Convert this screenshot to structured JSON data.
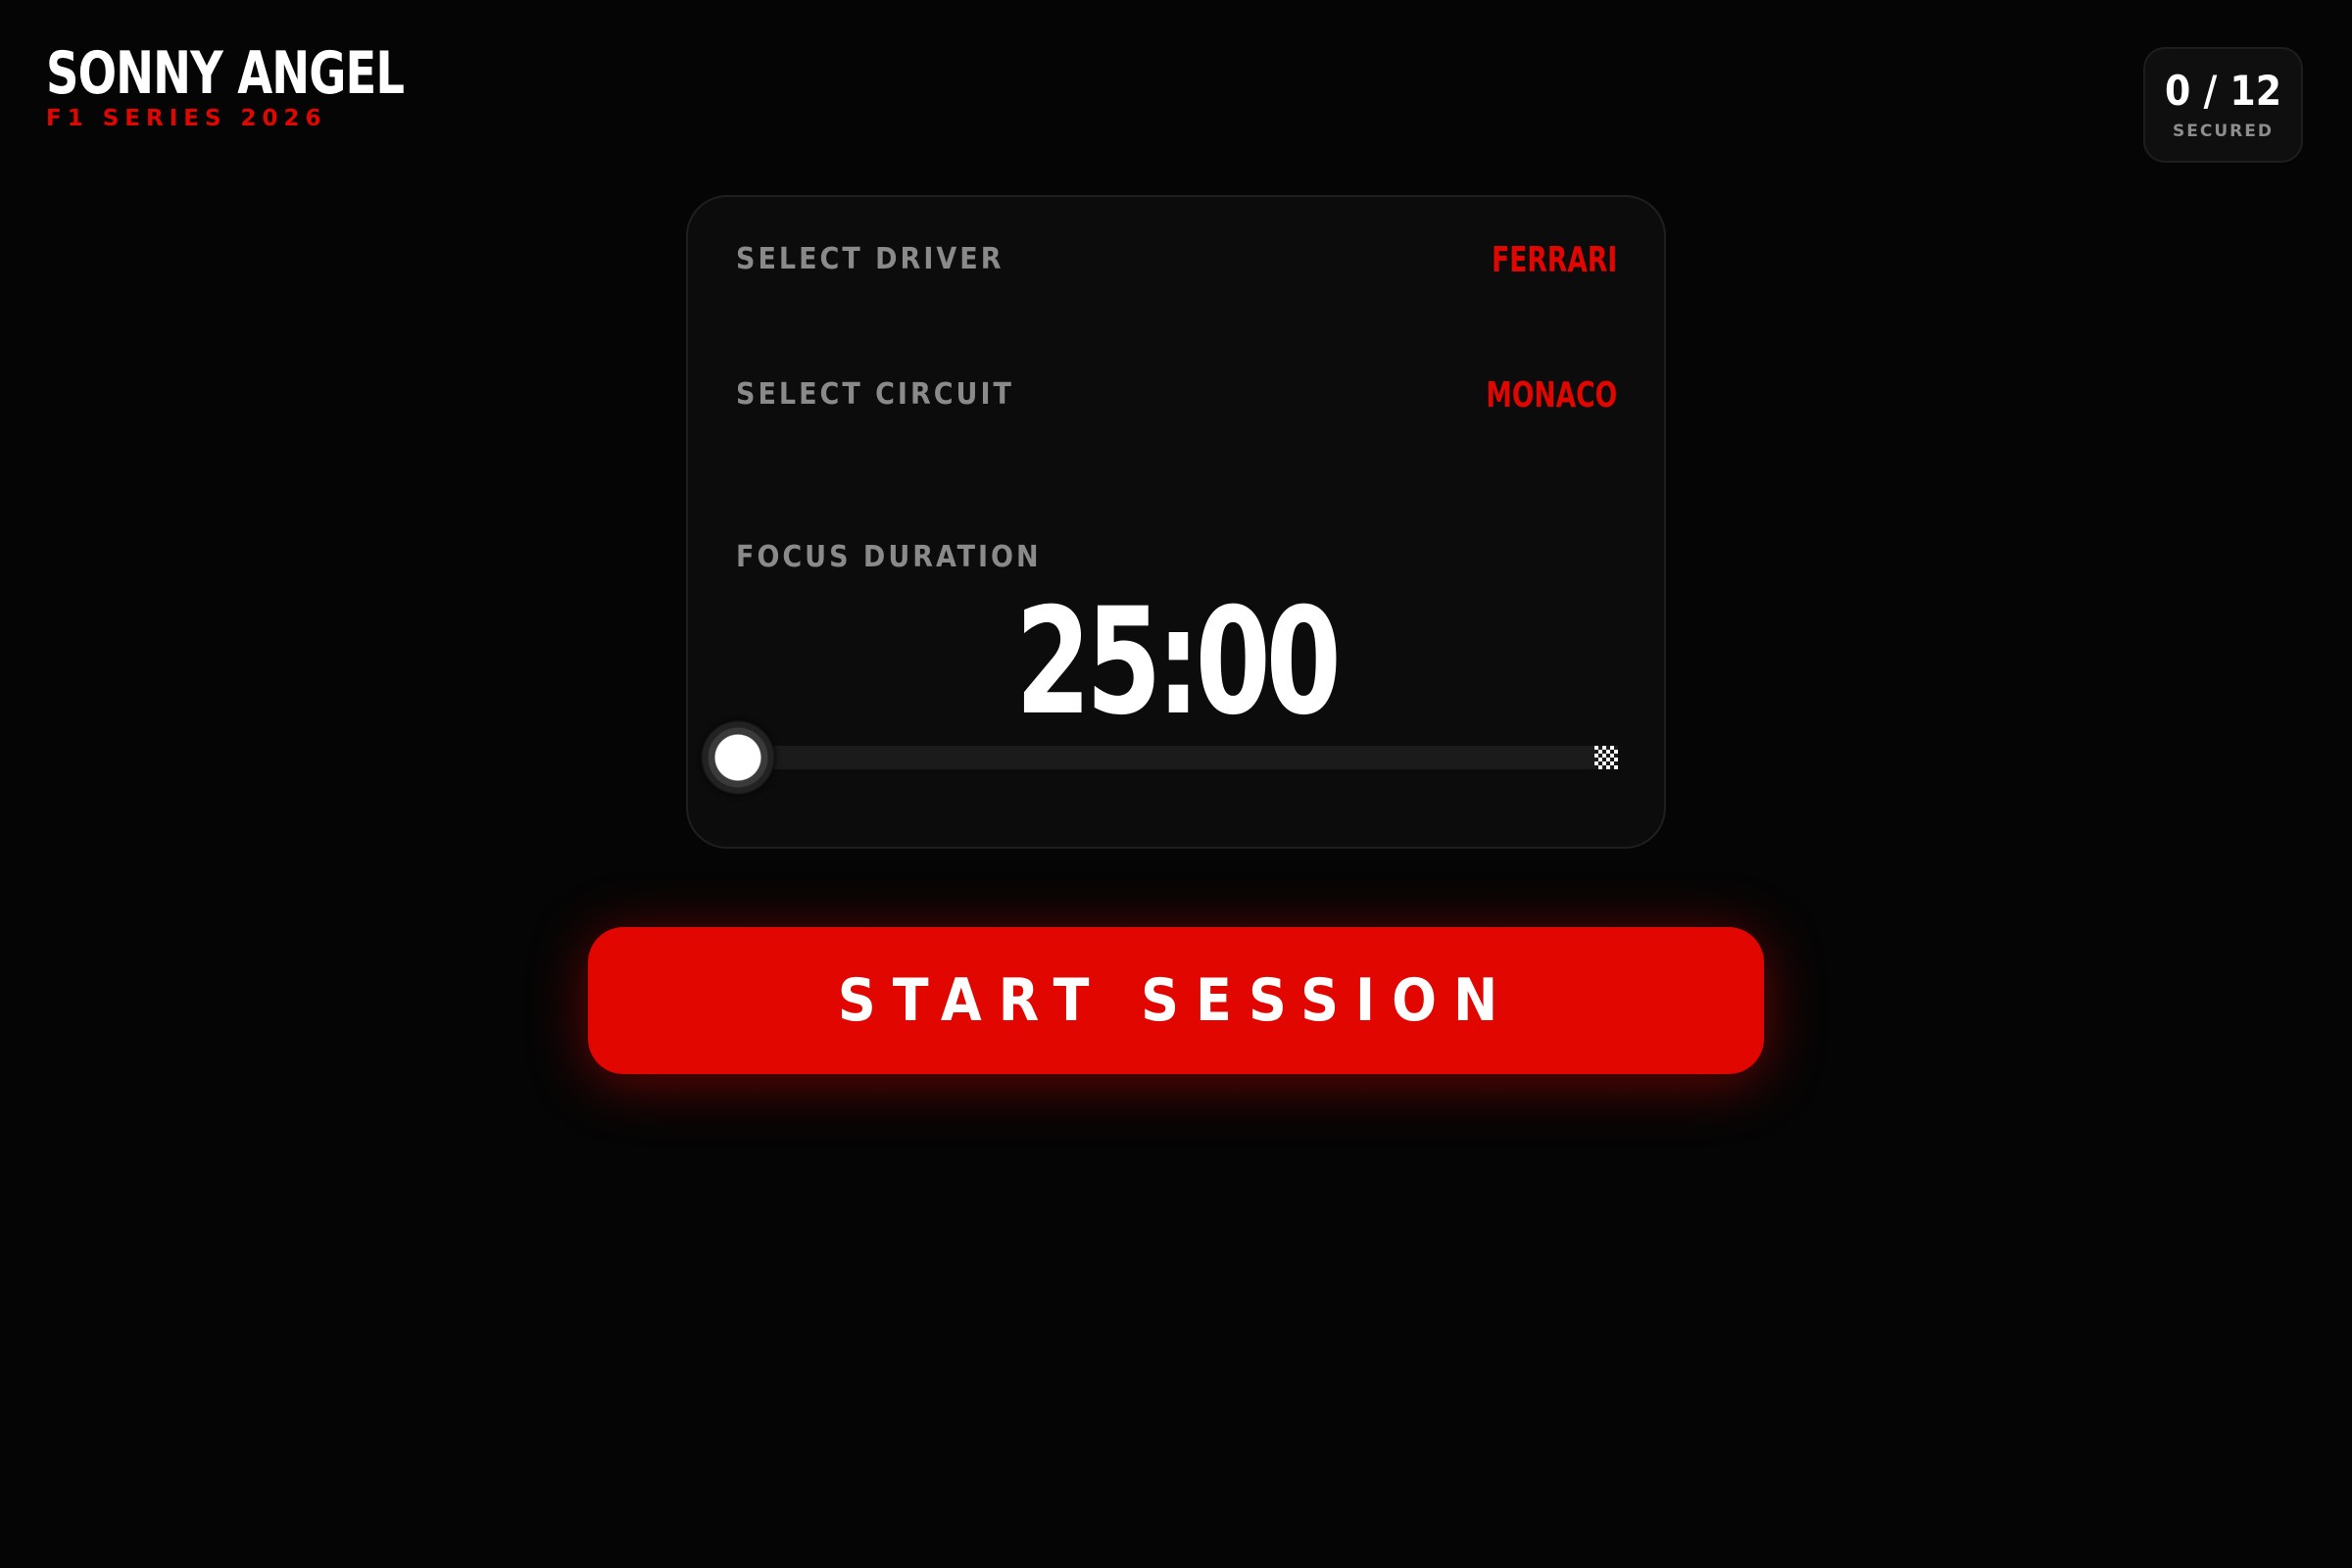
{
  "brand": {
    "title": "SONNY ANGEL",
    "subtitle": "F1 SERIES 2026"
  },
  "counter": {
    "value": "0 / 12",
    "label": "SECURED"
  },
  "card": {
    "driver": {
      "label": "SELECT DRIVER",
      "value": "FERRARI"
    },
    "circuit": {
      "label": "SELECT CIRCUIT",
      "value": "MONACO"
    },
    "duration": {
      "label": "FOCUS DURATION",
      "time": "25:00",
      "slider_progress": 0,
      "thumb_icon": "tire-icon",
      "end_icon": "checkered-flag-icon"
    }
  },
  "actions": {
    "start_label": "START SESSION"
  },
  "colors": {
    "accent": "#e10600",
    "background": "#050505",
    "card": "#0c0c0c",
    "label": "#8a8a8a"
  }
}
